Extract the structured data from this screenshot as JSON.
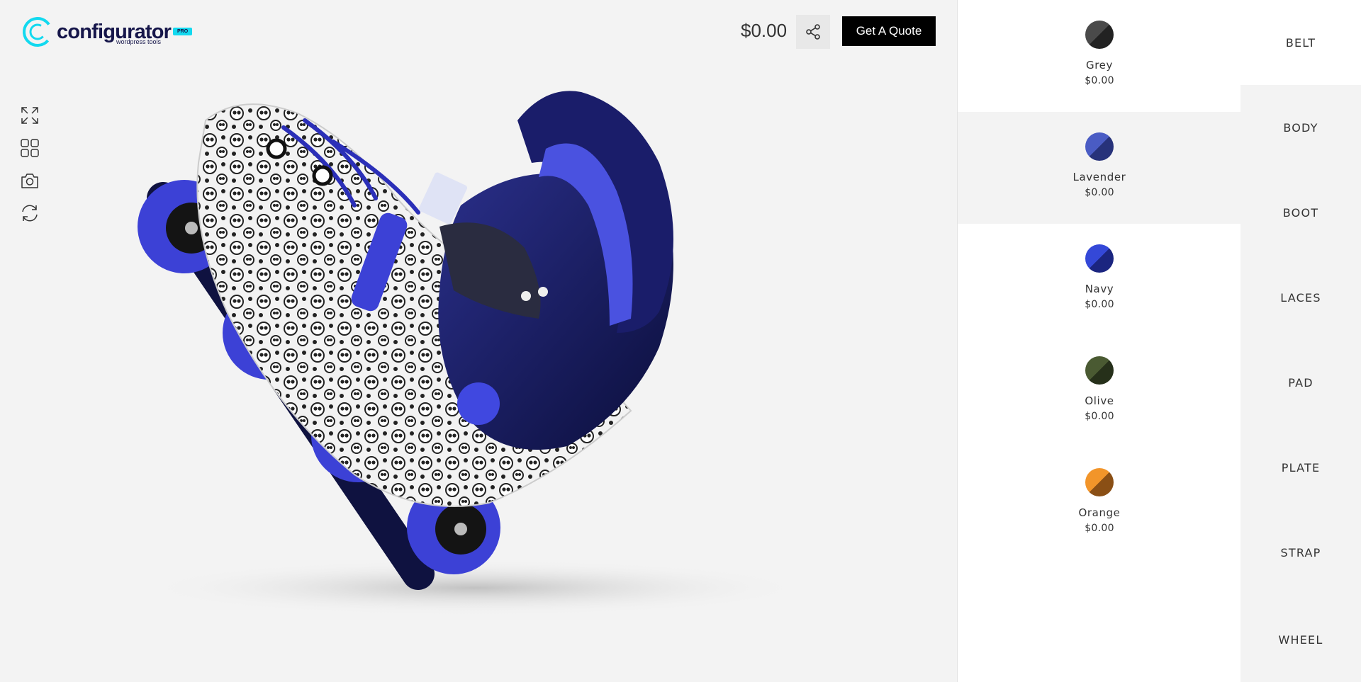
{
  "brand": {
    "name": "configurator",
    "tagline": "wordpress tools",
    "badge": "PRO",
    "accent": "#12d9ef"
  },
  "header": {
    "total_price": "$0.00",
    "quote_label": "Get A Quote"
  },
  "toolbar": [
    {
      "name": "fullscreen",
      "icon": "expand-icon"
    },
    {
      "name": "gallery",
      "icon": "grid-icon"
    },
    {
      "name": "screenshot",
      "icon": "camera-icon"
    },
    {
      "name": "reset",
      "icon": "refresh-icon"
    }
  ],
  "options": [
    {
      "name": "Grey",
      "price": "$0.00",
      "colors": [
        "#4a4a4a",
        "#222222"
      ]
    },
    {
      "name": "Lavender",
      "price": "$0.00",
      "colors": [
        "#4a5cc4",
        "#27327a"
      ]
    },
    {
      "name": "Navy",
      "price": "$0.00",
      "colors": [
        "#3448d8",
        "#1b2580"
      ]
    },
    {
      "name": "Olive",
      "price": "$0.00",
      "colors": [
        "#4a5a32",
        "#26301a"
      ]
    },
    {
      "name": "Orange",
      "price": "$0.00",
      "colors": [
        "#f2952a",
        "#8a4f15"
      ]
    }
  ],
  "selected_option": "Lavender",
  "categories": [
    "BELT",
    "BODY",
    "BOOT",
    "LACES",
    "PAD",
    "PLATE",
    "STRAP",
    "WHEEL"
  ],
  "active_category": "BELT"
}
